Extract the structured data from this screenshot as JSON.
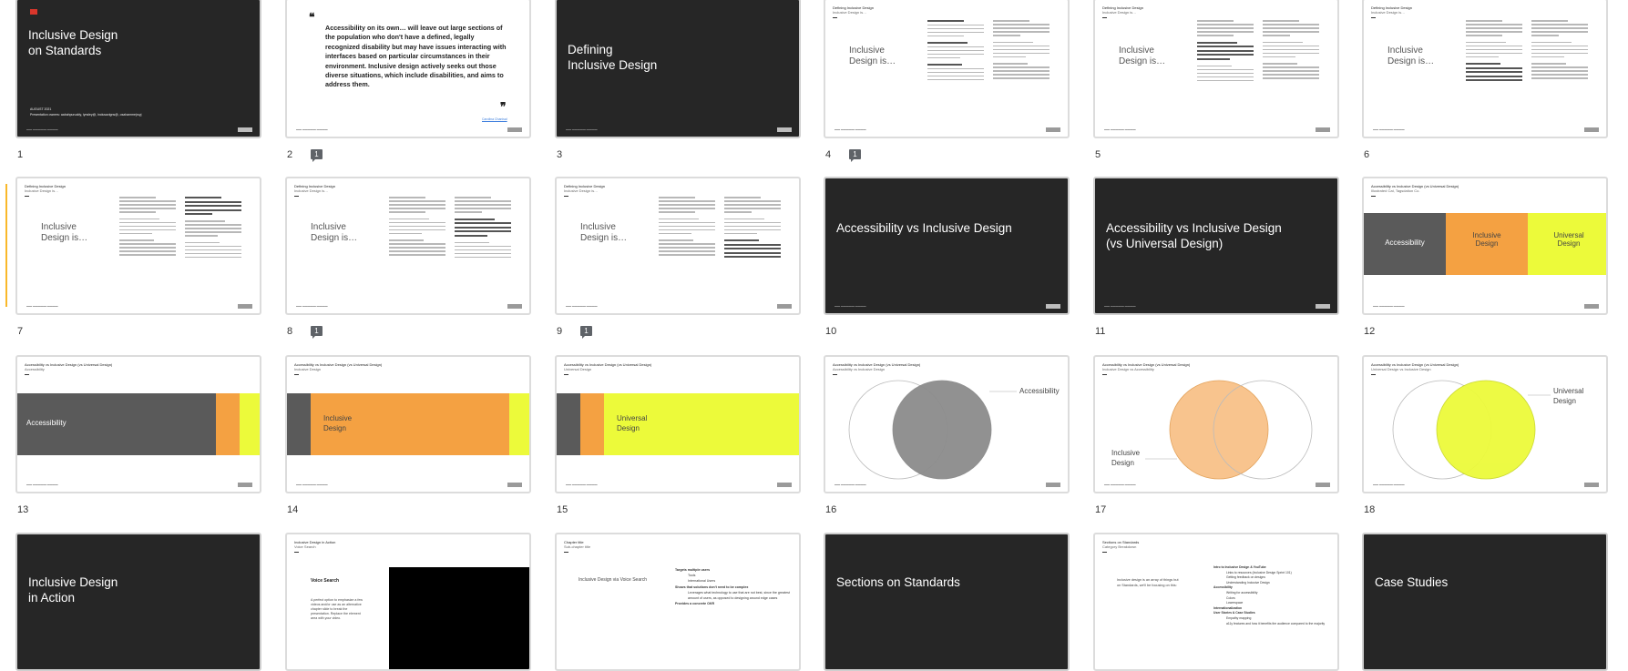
{
  "slides": [
    {
      "number": "1",
      "title": "Inclusive Design\non Standards",
      "subtitle": "AUGUST 2021",
      "byline": "Presentation owners: aabahpuruddy, lynsley@, inclusavigns@, osahammejroyj",
      "comments": ""
    },
    {
      "number": "2",
      "quote": "Accessibility on its own… will leave out large sections of the population who don't have a defined, legally recognized disability but may have issues interacting with interfaces based on particular circumstances in their environment. Inclusive design actively seeks out those diverse situations, which include disabilities, and aims to address them.",
      "attribution": "Carolina Chanisal",
      "comments": "1"
    },
    {
      "number": "3",
      "title": "Defining\nInclusive Design",
      "comments": ""
    },
    {
      "number": "4",
      "header": "Defining Inclusive Design",
      "subheader": "Inclusive Design is…",
      "left": "Inclusive\nDesign is…",
      "comments": "1"
    },
    {
      "number": "5",
      "header": "Defining Inclusive Design",
      "subheader": "Inclusive Design is…",
      "left": "Inclusive\nDesign is…",
      "comments": ""
    },
    {
      "number": "6",
      "header": "Defining Inclusive Design",
      "subheader": "Inclusive Design is…",
      "left": "Inclusive\nDesign is…",
      "comments": ""
    },
    {
      "number": "7",
      "header": "Defining Inclusive Design",
      "subheader": "Inclusive Design is…",
      "left": "Inclusive\nDesign is…",
      "comments": ""
    },
    {
      "number": "8",
      "header": "Defining Inclusive Design",
      "subheader": "Inclusive Design is…",
      "left": "Inclusive\nDesign is…",
      "comments": "1"
    },
    {
      "number": "9",
      "header": "Defining Inclusive Design",
      "subheader": "Inclusive Design is…",
      "left": "Inclusive\nDesign is…",
      "comments": "1"
    },
    {
      "number": "10",
      "title": "Accessibility vs Inclusive Design",
      "comments": ""
    },
    {
      "number": "11",
      "title": "Accessibility vs Inclusive Design\n(vs Universal Design)",
      "comments": ""
    },
    {
      "number": "12",
      "header": "Accessibility vs Inclusive Design (vs Universal Design)",
      "subheader": "Illustrated Cat, Tagsdation Co.",
      "labels": [
        "Accessibility",
        "Inclusive\nDesign",
        "Universal\nDesign"
      ],
      "comments": ""
    },
    {
      "number": "13",
      "header": "Accessibility vs Inclusive Design (vs Universal Design)",
      "subheader": "Accessibility",
      "label": "Accessibility",
      "comments": ""
    },
    {
      "number": "14",
      "header": "Accessibility vs Inclusive Design (vs Universal Design)",
      "subheader": "Inclusive Design",
      "label": "Inclusive\nDesign",
      "comments": ""
    },
    {
      "number": "15",
      "header": "Accessibility vs Inclusive Design (vs Universal Design)",
      "subheader": "Universal Design",
      "label": "Universal\nDesign",
      "comments": ""
    },
    {
      "number": "16",
      "header": "Accessibility vs Inclusive Design (vs Universal Design)",
      "subheader": "Accessibility vs Inclusive Design",
      "label": "Accessibility",
      "comments": ""
    },
    {
      "number": "17",
      "header": "Accessibility vs Inclusive Design (vs Universal Design)",
      "subheader": "Inclusive Design vs Accessibility",
      "label": "Inclusive\nDesign",
      "comments": ""
    },
    {
      "number": "18",
      "header": "Accessibility vs Inclusive Design (vs Universal Design)",
      "subheader": "Universal Design vs Inclusive Design",
      "label": "Universal\nDesign",
      "comments": ""
    },
    {
      "number": "19",
      "title": "Inclusive Design\nin Action",
      "comments": ""
    },
    {
      "number": "20",
      "header": "Inclusive Design in Action",
      "subheader": "Voice Search",
      "heading": "Voice Search",
      "body": "A perfect option to emphasize a few videos and/or use as an alternative chapter slide to break the presentation. Replace the element area with your video.",
      "comments": ""
    },
    {
      "number": "21",
      "header": "Chapter title",
      "subheader": "Sub-chapter title",
      "left": "Inclusive Design via Voice Search",
      "items": [
        "Targets multiple users",
        "Tools",
        "International Users",
        "Shows that solutions don't need to be complex",
        "Leverages what technology to use that are not best, since the greatest amount of users, as opposed to designing around edge cases",
        "Provides a concrete OKR"
      ],
      "comments": ""
    },
    {
      "number": "22",
      "title": "Sections on Standards",
      "comments": ""
    },
    {
      "number": "23",
      "header": "Sections on Standards",
      "subheader": "Category Breakdown",
      "left": "Inclusive design is an array of things but on Standards, we'll be focusing on this:",
      "items": [
        "Intro to Inclusive Design & YouTube",
        "Links to resources (Inclusive Design Sprint 101)",
        "Getting feedback on designs",
        "Understanding Inclusive Design",
        "Accessibility",
        "Writing for accessibility",
        "Colors",
        "Lowerspace",
        "Internationalization",
        "User Stories & Case Studies",
        "Empathy mapping",
        "a11y features and how it benefits the audience compared to the majority"
      ],
      "comments": ""
    },
    {
      "number": "24",
      "title": "Case Studies",
      "comments": ""
    }
  ],
  "colors": {
    "dark": "#262626",
    "gray": "#5a5a5a",
    "orange": "#f4a142",
    "yellow": "#ecfa3a",
    "accent": "#f9b82a",
    "venn_gray": "#8c8c8c",
    "venn_orange": "#f8c48e",
    "venn_yellow": "#ecfa3a"
  }
}
